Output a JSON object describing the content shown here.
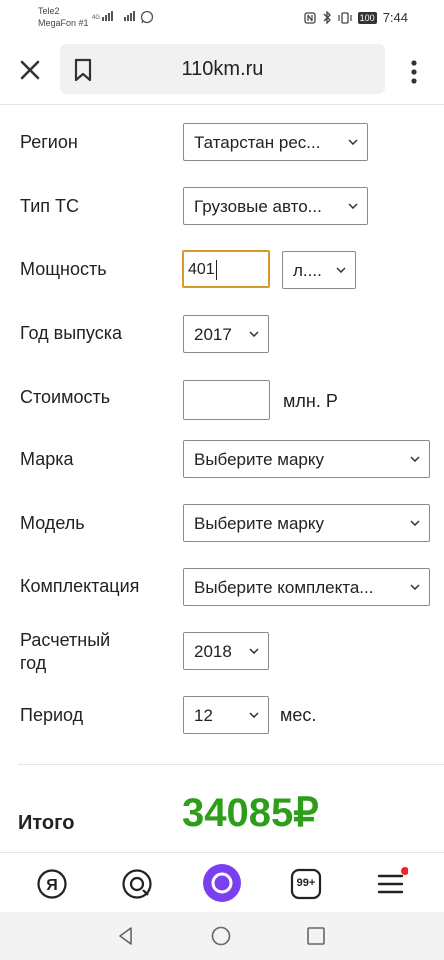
{
  "status_bar": {
    "carrier1": "Tele2",
    "carrier2": "MegaFon #1",
    "net": "4G",
    "battery": "100",
    "time": "7:44"
  },
  "browser": {
    "url": "110km.ru"
  },
  "form": {
    "region": {
      "label": "Регион",
      "value": "Татарстан рес..."
    },
    "vehicle_type": {
      "label": "Тип ТС",
      "value": "Грузовые авто..."
    },
    "power": {
      "label": "Мощность",
      "value": "401",
      "unit": "л...."
    },
    "year": {
      "label": "Год выпуска",
      "value": "2017"
    },
    "cost": {
      "label": "Стоимость",
      "value": "",
      "unit": "млн. Р"
    },
    "brand": {
      "label": "Марка",
      "value": "Выберите марку"
    },
    "model": {
      "label": "Модель",
      "value": "Выберите марку"
    },
    "trim": {
      "label": "Комплектация",
      "value": "Выберите комплекта..."
    },
    "calc_year": {
      "label_line1": "Расчетный",
      "label_line2": "год",
      "value": "2018"
    },
    "period": {
      "label": "Период",
      "value": "12",
      "unit": "мес."
    }
  },
  "total": {
    "label": "Итого",
    "value": "34085₽"
  },
  "bottom_nav": {
    "tabs_count": "99+"
  },
  "colors": {
    "total_green": "#2e9e1a",
    "active_input_border": "#d89a2a",
    "alice_purple": "#7b3ff2",
    "badge_red": "#f5222d"
  }
}
